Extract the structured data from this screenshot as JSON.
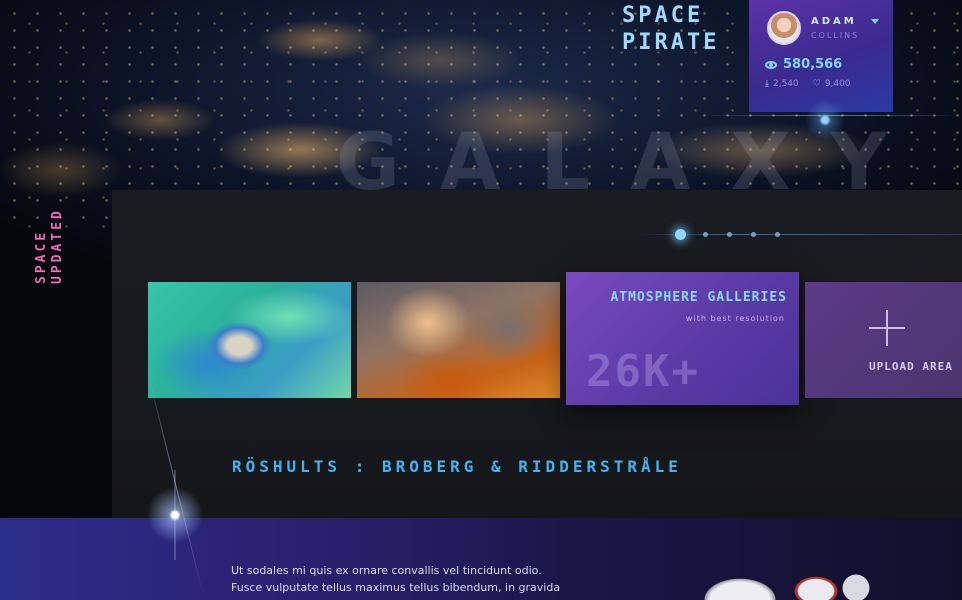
{
  "brand": {
    "line1": "SPACE",
    "line2": "PIRATE"
  },
  "hero": {
    "watermark": "GALAXY"
  },
  "profile": {
    "name": "ADAM",
    "surname": "COLLINS",
    "views": "580,566",
    "downloads": "2,540",
    "likes": "9,400"
  },
  "side_label": {
    "line1": "SPACE",
    "line2": "UPDATED"
  },
  "gallery": {
    "atmosphere": {
      "title": "ATMOSPHERE GALLERIES",
      "subtitle": "with best resolution",
      "count": "26K+"
    },
    "upload_label": "UPLOAD AREA"
  },
  "headline": "RÖSHULTS : BROBERG & RIDDERSTRÅLE",
  "footer": {
    "body_line1": "Ut sodales mi quis ex ornare convallis vel tincidunt odio.",
    "body_line2": "Fusce vulputate tellus maximus tellus bibendum, in gravida"
  },
  "colors": {
    "accent": "#3fb4f2",
    "pink": "#f06ab6",
    "purple": "#5b3aa6"
  }
}
